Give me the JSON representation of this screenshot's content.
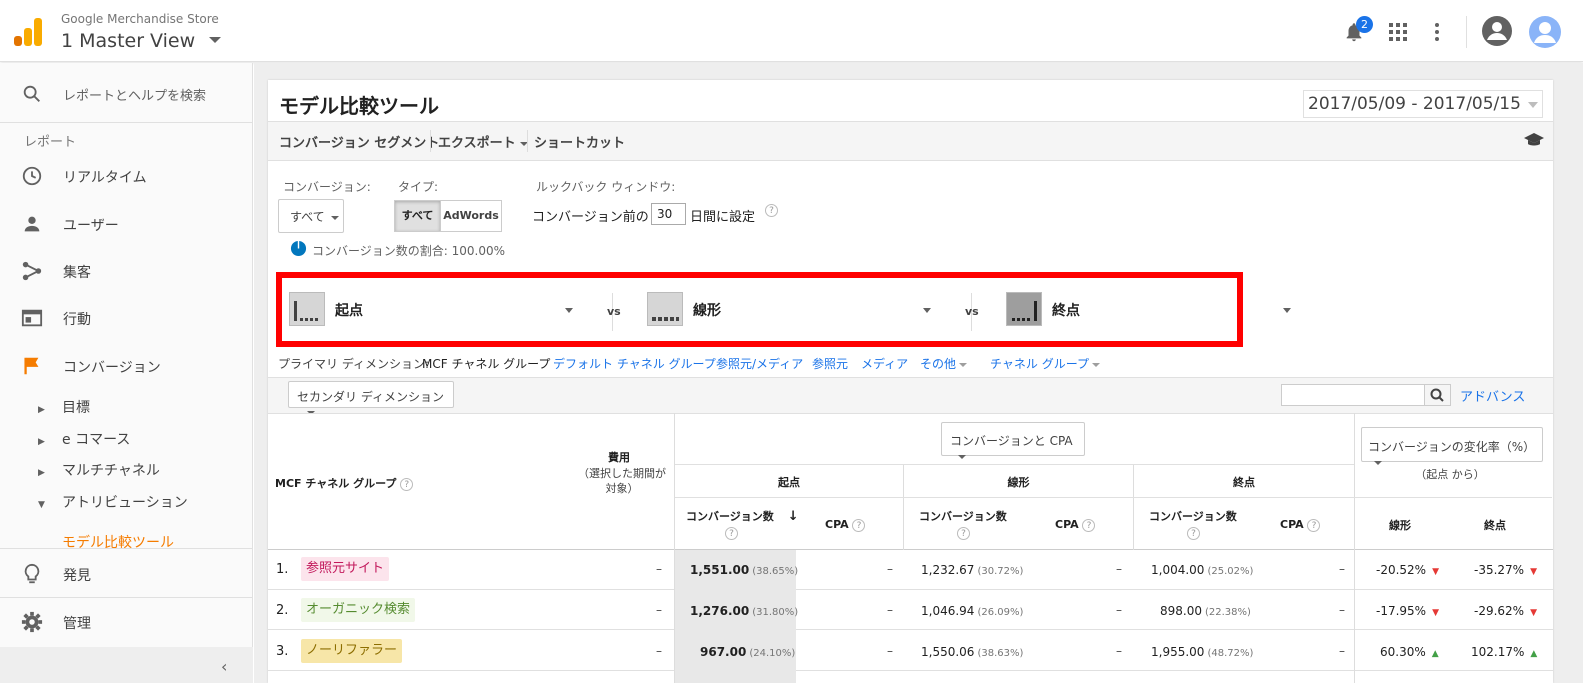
{
  "header": {
    "account": "Google Merchandise Store",
    "view": "1 Master View",
    "notification_count": "2"
  },
  "sidebar": {
    "search_label": "レポートとヘルプを検索",
    "section_label": "レポート",
    "items": [
      {
        "label": "リアルタイム",
        "icon": "clock-icon"
      },
      {
        "label": "ユーザー",
        "icon": "person-icon"
      },
      {
        "label": "集客",
        "icon": "acquisition-icon"
      },
      {
        "label": "行動",
        "icon": "behavior-icon"
      },
      {
        "label": "コンバージョン",
        "icon": "flag-icon"
      }
    ],
    "sub_items": [
      "目標",
      "e コマース",
      "マルチチャネル",
      "アトリビューション"
    ],
    "active_item": "モデル比較ツール",
    "bottom_items": [
      {
        "label": "発見",
        "icon": "lightbulb-icon"
      },
      {
        "label": "管理",
        "icon": "gear-icon"
      }
    ]
  },
  "page": {
    "title": "モデル比較ツール",
    "date_range": "2017/05/09 - 2017/05/15"
  },
  "toolbar": {
    "conversion_segment": "コンバージョン セグメント",
    "export": "エクスポート",
    "shortcut": "ショートカット"
  },
  "controls": {
    "conversion_label": "コンバージョン:",
    "conversion_value": "すべて",
    "type_label": "タイプ:",
    "type_all": "すべて",
    "type_adwords": "AdWords",
    "lookback_label": "ルックバック ウィンドウ:",
    "lookback_prefix": "コンバージョン前の",
    "lookback_days": "30",
    "lookback_suffix": "日間に設定",
    "share_text": "コンバージョン数の割合: 100.00%"
  },
  "models": {
    "m1": "起点",
    "m2": "線形",
    "m3": "終点",
    "vs": "vs"
  },
  "dimensions": {
    "label": "プライマリ ディメンション:",
    "active": "MCF チャネル グループ",
    "links": [
      "デフォルト チャネル グループ",
      "参照元/メディア",
      "参照元",
      "メディア",
      "その他",
      "チャネル グループ"
    ]
  },
  "secondary": {
    "label": "セカンダリ ディメンション",
    "advanced": "アドバンス"
  },
  "table": {
    "col_group": "MCF チャネル グループ",
    "cost_label": "費用",
    "cost_sub": "（選択した期間が対象）",
    "metric_select": "コンバージョンと CPA",
    "change_select": "コンバージョンの変化率（%）",
    "change_sub": "（起点 から）",
    "model_heads": [
      "起点",
      "線形",
      "終点"
    ],
    "conv_label": "コンバージョン数",
    "cpa_label": "CPA",
    "change_heads": [
      "線形",
      "終点"
    ],
    "rows": [
      {
        "num": "1.",
        "name": "参照元サイト",
        "chip_bg": "#fce4ec",
        "chip_fg": "#c2185b",
        "cost": "–",
        "c1": "1,551.00",
        "p1": "(38.65%)",
        "cpa1": "–",
        "c2": "1,232.67",
        "p2": "(30.72%)",
        "cpa2": "–",
        "c3": "1,004.00",
        "p3": "(25.02%)",
        "cpa3": "–",
        "ch1": "-20.52%",
        "d1": "down",
        "ch2": "-35.27%",
        "d2": "down"
      },
      {
        "num": "2.",
        "name": "オーガニック検索",
        "chip_bg": "#f1f8e9",
        "chip_fg": "#558b2f",
        "cost": "–",
        "c1": "1,276.00",
        "p1": "(31.80%)",
        "cpa1": "–",
        "c2": "1,046.94",
        "p2": "(26.09%)",
        "cpa2": "–",
        "c3": "898.00",
        "p3": "(22.38%)",
        "cpa3": "–",
        "ch1": "-17.95%",
        "d1": "down",
        "ch2": "-29.62%",
        "d2": "down"
      },
      {
        "num": "3.",
        "name": "ノーリファラー",
        "chip_bg": "#f7e6a8",
        "chip_fg": "#8d6e00",
        "cost": "–",
        "c1": "967.00",
        "p1": "(24.10%)",
        "cpa1": "–",
        "c2": "1,550.06",
        "p2": "(38.63%)",
        "cpa2": "–",
        "c3": "1,955.00",
        "p3": "(48.72%)",
        "cpa3": "–",
        "ch1": "60.30%",
        "d1": "up",
        "ch2": "102.17%",
        "d2": "up"
      }
    ]
  },
  "colors": {
    "accent": "#f57c00",
    "link": "#1a73e8",
    "highlight_box": "#ff0000"
  }
}
